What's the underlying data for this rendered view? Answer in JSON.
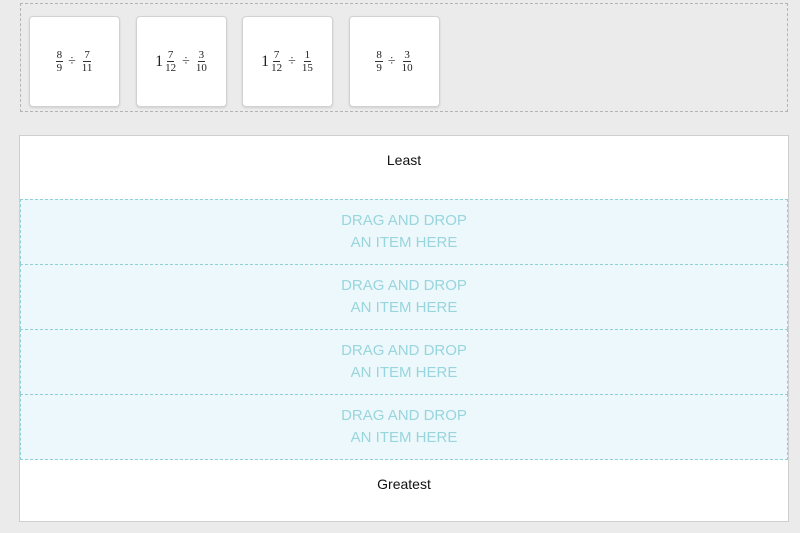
{
  "bank": {
    "cards": [
      {
        "whole": "",
        "a_num": "8",
        "a_den": "9",
        "op": "÷",
        "b_num": "7",
        "b_den": "11"
      },
      {
        "whole": "1",
        "a_num": "7",
        "a_den": "12",
        "op": "÷",
        "b_num": "3",
        "b_den": "10"
      },
      {
        "whole": "1",
        "a_num": "7",
        "a_den": "12",
        "op": "÷",
        "b_num": "1",
        "b_den": "15"
      },
      {
        "whole": "",
        "a_num": "8",
        "a_den": "9",
        "op": "÷",
        "b_num": "3",
        "b_den": "10"
      }
    ]
  },
  "sorter": {
    "top_label": "Least",
    "bottom_label": "Greatest",
    "slots": [
      {
        "line1": "DRAG AND DROP",
        "line2": "AN ITEM HERE"
      },
      {
        "line1": "DRAG AND DROP",
        "line2": "AN ITEM HERE"
      },
      {
        "line1": "DRAG AND DROP",
        "line2": "AN ITEM HERE"
      },
      {
        "line1": "DRAG AND DROP",
        "line2": "AN ITEM HERE"
      }
    ]
  },
  "colors": {
    "slot_background": "#ecf8fb",
    "slot_border": "#8fd0d6",
    "slot_text": "#99d5dd"
  }
}
